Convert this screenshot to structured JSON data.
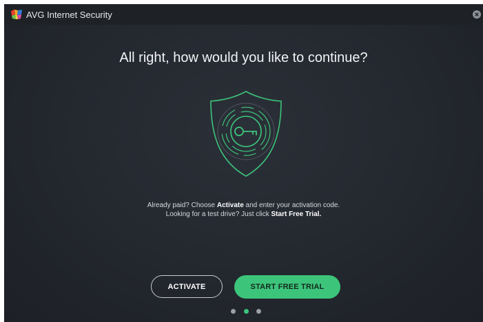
{
  "window": {
    "title": "AVG Internet Security",
    "logo_icon": "avg-logo",
    "close_icon": "close-icon"
  },
  "main": {
    "headline": "All right, how would you like to continue?",
    "illustration_icon": "shield-key-icon",
    "description": {
      "line1_prefix": "Already paid? Choose ",
      "line1_bold": "Activate",
      "line1_suffix": " and enter your activation code.",
      "line2_prefix": "Looking for a test drive? Just click ",
      "line2_bold": "Start Free Trial."
    }
  },
  "actions": {
    "activate_label": "ACTIVATE",
    "trial_label": "START FREE TRIAL"
  },
  "pager": {
    "total": 3,
    "active_index": 1
  },
  "colors": {
    "accent": "#3dc47b",
    "background": "#23272e",
    "titlebar": "#1e2126"
  }
}
